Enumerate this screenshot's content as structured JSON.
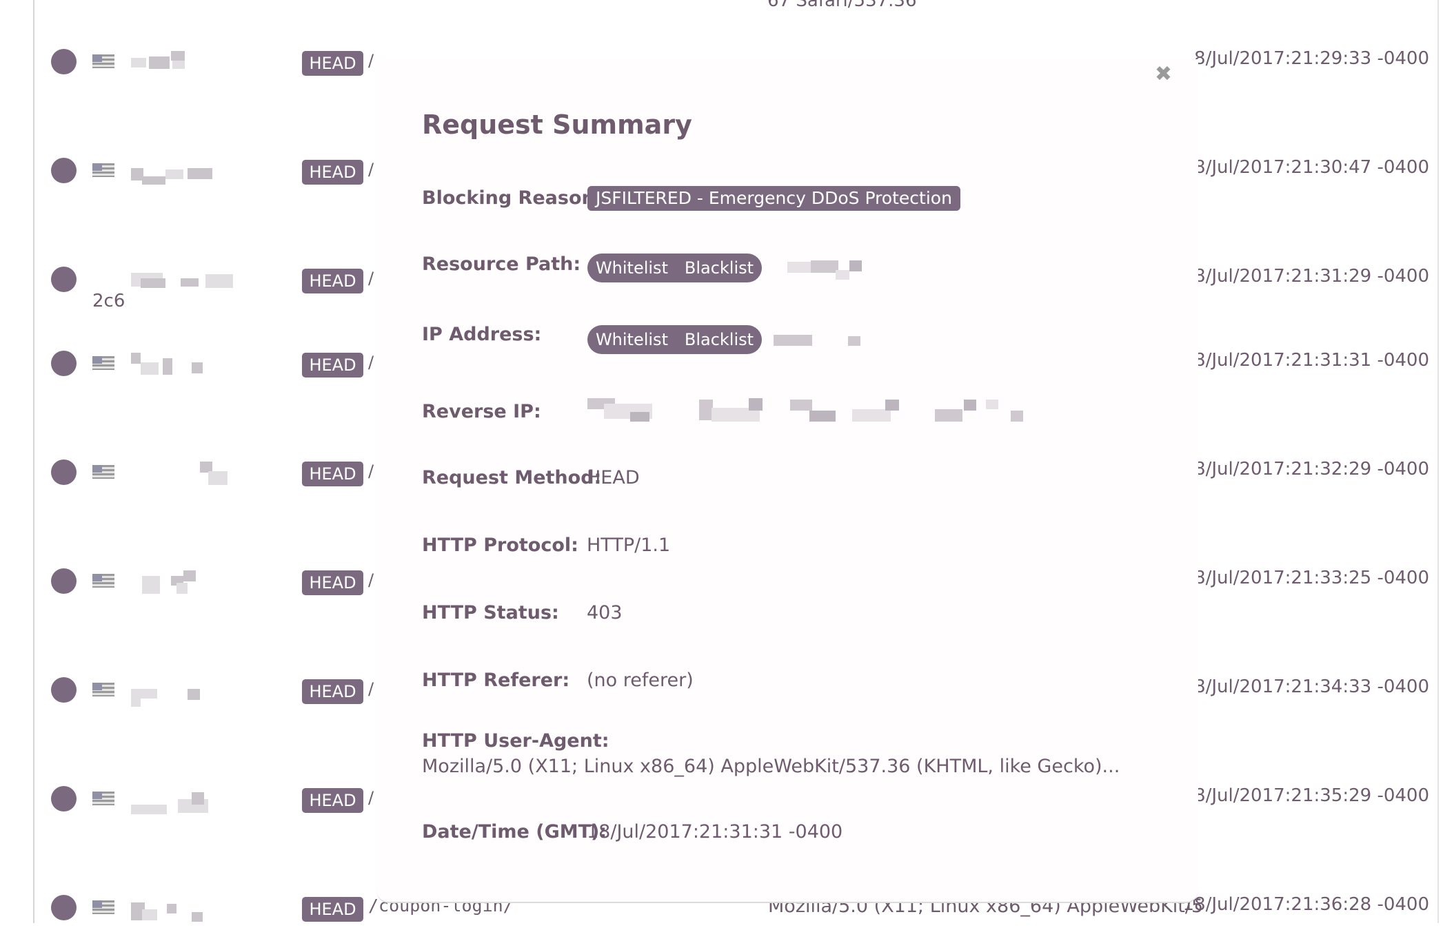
{
  "top_fragment": "67 Safari/537.36",
  "rows": [
    {
      "method": "HEAD",
      "path": "/",
      "timestamp": "8/Jul/2017:21:29:33 -0400"
    },
    {
      "method": "HEAD",
      "path": "/",
      "timestamp": "8/Jul/2017:21:30:47 -0400"
    },
    {
      "method": "HEAD",
      "path": "/",
      "timestamp": "8/Jul/2017:21:31:29 -0400",
      "extra": "2c6"
    },
    {
      "method": "HEAD",
      "path": "/",
      "timestamp": "8/Jul/2017:21:31:31 -0400"
    },
    {
      "method": "HEAD",
      "path": "/",
      "timestamp": "8/Jul/2017:21:32:29 -0400"
    },
    {
      "method": "HEAD",
      "path": "/",
      "timestamp": "8/Jul/2017:21:33:25 -0400"
    },
    {
      "method": "HEAD",
      "path": "/",
      "timestamp": "8/Jul/2017:21:34:33 -0400"
    },
    {
      "method": "HEAD",
      "path": "/",
      "timestamp": "8/Jul/2017:21:35:29 -0400"
    },
    {
      "method": "HEAD",
      "path": "/coupon-login/",
      "user_agent": "Mozilla/5.0 (X11; Linux x86_64) AppleWebKit/5",
      "timestamp": "18/Jul/2017:21:36:28 -0400"
    }
  ],
  "modal": {
    "close_icon": "close-icon",
    "title": "Request Summary",
    "blocking_reason": {
      "label": "Blocking Reason:",
      "value": "JSFILTERED - Emergency DDoS Protection"
    },
    "resource_path": {
      "label": "Resource Path:",
      "whitelist": "Whitelist",
      "blacklist": "Blacklist"
    },
    "ip_address": {
      "label": "IP Address:",
      "whitelist": "Whitelist",
      "blacklist": "Blacklist"
    },
    "reverse_ip": {
      "label": "Reverse IP:"
    },
    "request_method": {
      "label": "Request Method:",
      "value": "HEAD"
    },
    "http_protocol": {
      "label": "HTTP Protocol:",
      "value": "HTTP/1.1"
    },
    "http_status": {
      "label": "HTTP Status:",
      "value": "403"
    },
    "http_referer": {
      "label": "HTTP Referer:",
      "value": "(no referer)"
    },
    "user_agent": {
      "label": "HTTP User-Agent:",
      "value": "Mozilla/5.0 (X11; Linux x86_64) AppleWebKit/537.36 (KHTML, like Gecko)..."
    },
    "datetime": {
      "label": "Date/Time (GMT):",
      "value": "18/Jul/2017:21:31:31 -0400"
    }
  },
  "colors": {
    "accent": "#7b6a7f",
    "text": "#6e5c6e",
    "background": "#ffffff"
  }
}
